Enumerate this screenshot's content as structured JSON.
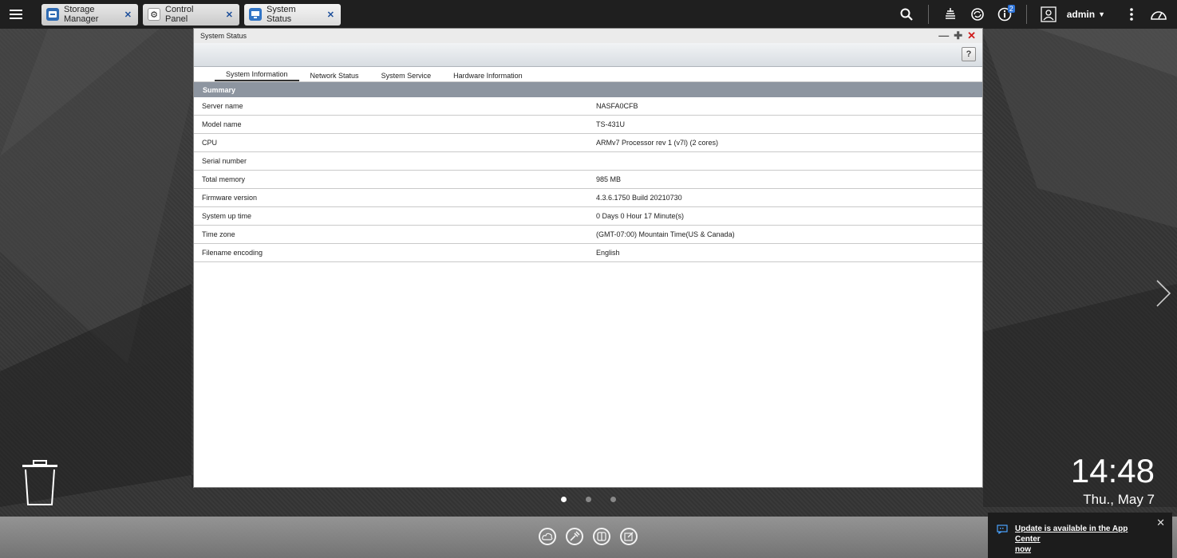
{
  "taskbar": {
    "tabs": [
      {
        "label": "Storage Manager",
        "icon": "storage-manager-icon"
      },
      {
        "label": "Control Panel",
        "icon": "gear-icon"
      },
      {
        "label": "System Status",
        "icon": "monitor-icon",
        "active": true
      }
    ],
    "user": "admin",
    "notification_badge": "2"
  },
  "window": {
    "title": "System Status",
    "help_label": "?",
    "tabs": [
      "System Information",
      "Network Status",
      "System Service",
      "Hardware Information"
    ],
    "active_tab": "System Information",
    "section_title": "Summary",
    "rows": [
      {
        "label": "Server name",
        "value": "NASFA0CFB"
      },
      {
        "label": "Model name",
        "value": "TS-431U"
      },
      {
        "label": "CPU",
        "value": "ARMv7 Processor rev 1 (v7l) (2 cores)"
      },
      {
        "label": "Serial number",
        "value": ""
      },
      {
        "label": "Total memory",
        "value": "985 MB"
      },
      {
        "label": "Firmware version",
        "value": "4.3.6.1750 Build 20210730"
      },
      {
        "label": "System up time",
        "value": "0 Days 0 Hour 17 Minute(s)"
      },
      {
        "label": "Time zone",
        "value": "(GMT-07:00) Mountain Time(US & Canada)"
      },
      {
        "label": "Filename encoding",
        "value": "English"
      }
    ]
  },
  "clock": {
    "time": "14:48",
    "date": "Thu., May 7"
  },
  "notification": {
    "text_line1": "Update is available in the App Center",
    "text_line2": "now"
  },
  "colors": {
    "taskbar": "#1f1f1f",
    "summary_header": "#8d95a0",
    "close": "#d01c1c",
    "badge": "#2d73d8"
  }
}
